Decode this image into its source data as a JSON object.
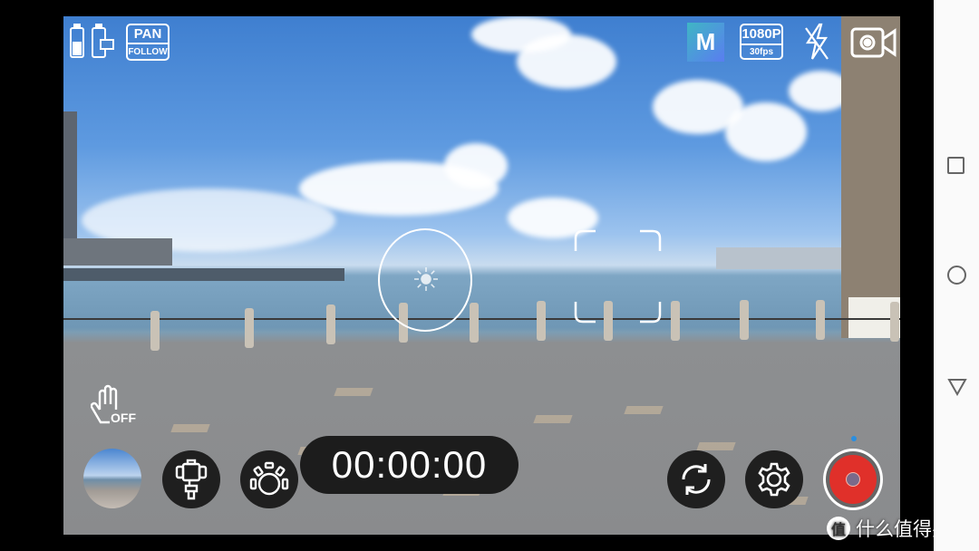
{
  "top_left": {
    "battery_phone": "battery-icon",
    "battery_gimbal": "gimbal-battery-icon",
    "mode_top": "PAN",
    "mode_bottom": "FOLLOW"
  },
  "top_right": {
    "shoot_mode": "M",
    "resolution": "1080P",
    "fps": "30fps",
    "flash": "flash-off-icon",
    "camera_mode": "video-camera-icon"
  },
  "gesture": {
    "label": "OFF"
  },
  "timer": "00:00:00",
  "colors": {
    "record": "#e0302a",
    "mode_m": "#3fa9c9"
  },
  "watermark": {
    "logo": "值",
    "text": "什么值得买"
  }
}
